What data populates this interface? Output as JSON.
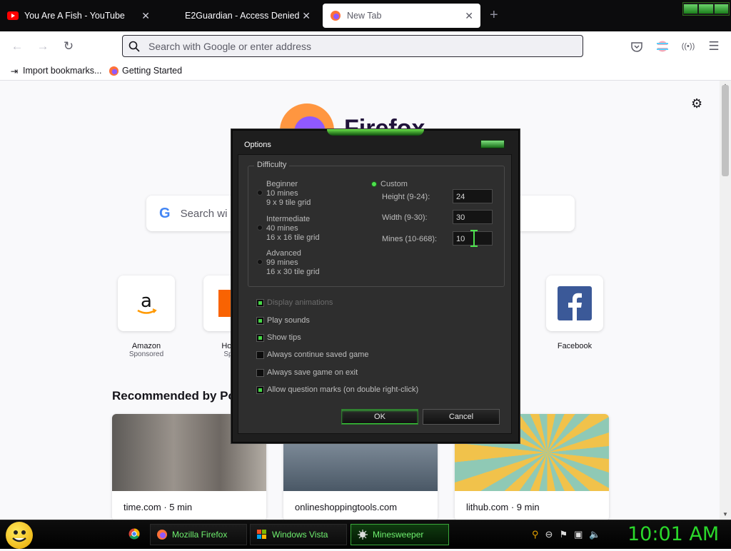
{
  "browser": {
    "tabs": [
      {
        "title": "You Are A Fish - YouTube",
        "icon": "youtube-icon",
        "active": false
      },
      {
        "title": "E2Guardian - Access Denied",
        "icon": "",
        "active": false
      },
      {
        "title": "New Tab",
        "icon": "firefox-icon",
        "active": true
      }
    ],
    "new_tab_symbol": "+",
    "url_placeholder": "Search with Google or enter address",
    "bookmarks": [
      {
        "label": "Import bookmarks...",
        "icon": "import-icon"
      },
      {
        "label": "Getting Started",
        "icon": "firefox-icon"
      }
    ]
  },
  "newtab": {
    "logo_text": "Firefox",
    "search_placeholder": "Search wi",
    "top_sites": [
      {
        "name": "Amazon",
        "sponsored": "Sponsored"
      },
      {
        "name": "Home",
        "sponsored": "Spon"
      },
      {
        "name": "Facebook",
        "sponsored": ""
      }
    ],
    "recommended_title": "Recommended by Poc",
    "cards": [
      {
        "source": "time.com · 5 min"
      },
      {
        "source": "onlineshoppingtools.com"
      },
      {
        "source": "lithub.com · 9 min"
      }
    ]
  },
  "dialog": {
    "title": "Options",
    "difficulty_label": "Difficulty",
    "levels": [
      {
        "name": "Beginner",
        "mines": "10 mines",
        "grid": "9 x 9 tile grid",
        "selected": false
      },
      {
        "name": "Intermediate",
        "mines": "40 mines",
        "grid": "16 x 16 tile grid",
        "selected": false
      },
      {
        "name": "Advanced",
        "mines": "99 mines",
        "grid": "16 x 30 tile grid",
        "selected": false
      }
    ],
    "custom": {
      "label": "Custom",
      "selected": true,
      "height_label": "Height (9-24):",
      "height_value": "24",
      "width_label": "Width (9-30):",
      "width_value": "30",
      "mines_label": "Mines (10-668):",
      "mines_value": "10"
    },
    "options": [
      {
        "label": "Display animations",
        "checked": true,
        "disabled": true
      },
      {
        "label": "Play sounds",
        "checked": true,
        "disabled": false
      },
      {
        "label": "Show tips",
        "checked": true,
        "disabled": false
      },
      {
        "label": "Always continue saved game",
        "checked": false,
        "disabled": false
      },
      {
        "label": "Always save game on exit",
        "checked": false,
        "disabled": false
      },
      {
        "label": "Allow question marks (on double right-click)",
        "checked": true,
        "disabled": false
      }
    ],
    "ok_label": "OK",
    "cancel_label": "Cancel"
  },
  "taskbar": {
    "items": [
      {
        "label": "",
        "icon": "chrome-icon"
      },
      {
        "label": "Mozilla Firefox",
        "icon": "firefox-icon"
      },
      {
        "label": "Windows Vista",
        "icon": "vista-icon"
      },
      {
        "label": "Minesweeper",
        "icon": "mine-icon",
        "active": true
      }
    ],
    "clock": "10:01 AM"
  },
  "colors": {
    "accent_green": "#46d646",
    "clock_green": "#2bd82b"
  }
}
